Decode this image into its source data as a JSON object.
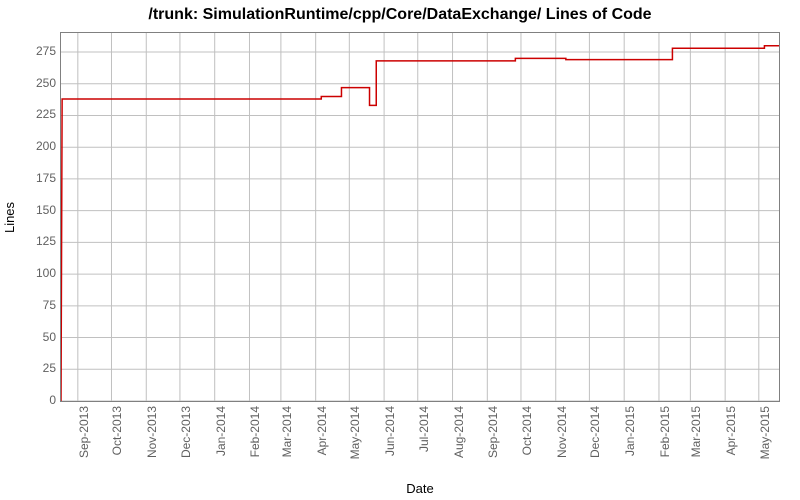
{
  "chart_data": {
    "type": "line",
    "title": "/trunk: SimulationRuntime/cpp/Core/DataExchange/ Lines of Code",
    "xlabel": "Date",
    "ylabel": "Lines",
    "ylim": [
      0,
      290
    ],
    "yticks": [
      0,
      25,
      50,
      75,
      100,
      125,
      150,
      175,
      200,
      225,
      250,
      275
    ],
    "xticks": [
      "Sep-2013",
      "Oct-2013",
      "Nov-2013",
      "Dec-2013",
      "Jan-2014",
      "Feb-2014",
      "Mar-2014",
      "Apr-2014",
      "May-2014",
      "Jun-2014",
      "Jul-2014",
      "Aug-2014",
      "Sep-2014",
      "Oct-2014",
      "Nov-2014",
      "Dec-2014",
      "Jan-2015",
      "Feb-2015",
      "Mar-2015",
      "Apr-2015",
      "May-2015"
    ],
    "x_range_days": 640,
    "series": [
      {
        "name": "Lines of Code",
        "color": "#cc0000",
        "points": [
          {
            "t": 0,
            "v": 0
          },
          {
            "t": 1,
            "v": 238
          },
          {
            "t": 232,
            "v": 238
          },
          {
            "t": 232,
            "v": 240
          },
          {
            "t": 250,
            "v": 240
          },
          {
            "t": 250,
            "v": 247
          },
          {
            "t": 275,
            "v": 247
          },
          {
            "t": 275,
            "v": 233
          },
          {
            "t": 281,
            "v": 233
          },
          {
            "t": 281,
            "v": 268
          },
          {
            "t": 405,
            "v": 268
          },
          {
            "t": 405,
            "v": 270
          },
          {
            "t": 450,
            "v": 270
          },
          {
            "t": 450,
            "v": 269
          },
          {
            "t": 545,
            "v": 269
          },
          {
            "t": 545,
            "v": 278
          },
          {
            "t": 627,
            "v": 278
          },
          {
            "t": 627,
            "v": 280
          },
          {
            "t": 640,
            "v": 280
          }
        ]
      }
    ],
    "xtick_positions_days": [
      15,
      45,
      76,
      106,
      137,
      168,
      196,
      227,
      257,
      288,
      318,
      349,
      380,
      410,
      441,
      471,
      502,
      533,
      561,
      592,
      622
    ]
  }
}
